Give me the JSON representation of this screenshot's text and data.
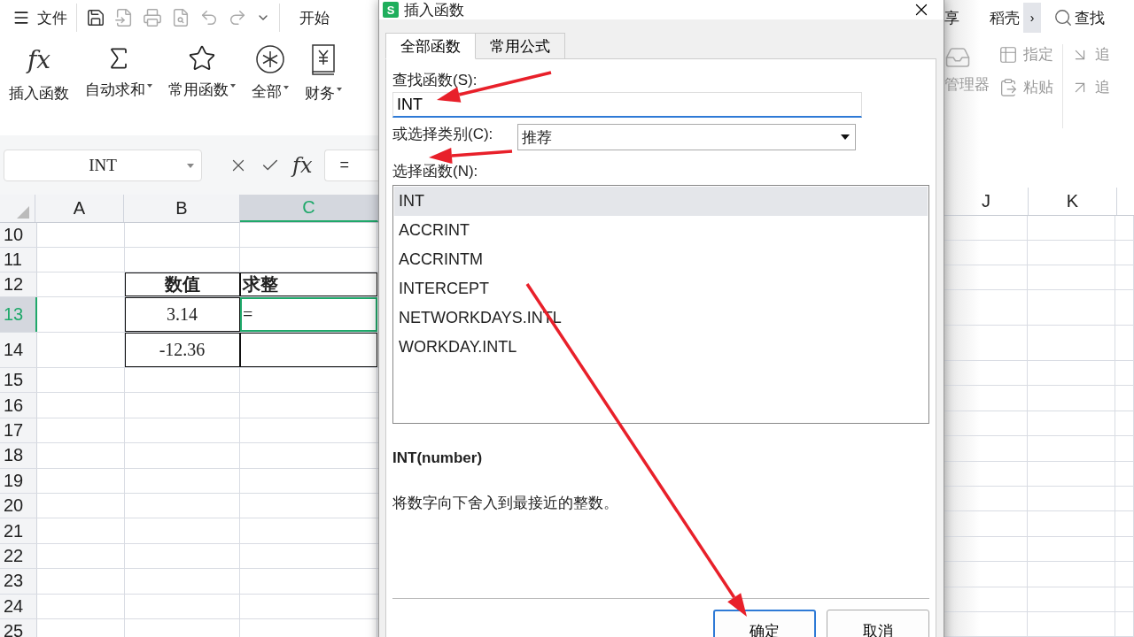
{
  "quick_bar": {
    "menu_label": "文件",
    "tab_label": "开始"
  },
  "ribbon": [
    {
      "icon_text": "fx",
      "label": "插入函数",
      "dropdown": false
    },
    {
      "label": "自动求和",
      "dropdown": true
    },
    {
      "label": "常用函数",
      "dropdown": true
    },
    {
      "label": "全部",
      "dropdown": true
    },
    {
      "label": "财务",
      "dropdown": true
    }
  ],
  "formula_bar": {
    "name_box": "INT",
    "fx_label": "fx",
    "content": "="
  },
  "sheet": {
    "columns": [
      {
        "label": "A",
        "selected": false
      },
      {
        "label": "B",
        "selected": false
      },
      {
        "label": "C",
        "selected": true
      }
    ],
    "rows": [
      {
        "number": "10",
        "selected": false,
        "cells": []
      },
      {
        "number": "11",
        "selected": false,
        "cells": []
      },
      {
        "number": "12",
        "selected": false,
        "cells": [
          "",
          {
            "text": "数值",
            "bold": true,
            "bordered": true,
            "active": false
          },
          {
            "text": "求整",
            "bold": true,
            "bordered": true,
            "active": false
          }
        ]
      },
      {
        "number": "13",
        "selected": true,
        "cells": [
          "",
          {
            "text": "3.14",
            "bold": false,
            "bordered": true,
            "active": false
          },
          {
            "text": "=",
            "bold": false,
            "bordered": true,
            "active": true
          }
        ]
      },
      {
        "number": "14",
        "selected": false,
        "cells": [
          "",
          {
            "text": "-12.36",
            "bold": false,
            "bordered": true,
            "active": false
          },
          {
            "text": "",
            "bold": false,
            "bordered": true,
            "active": false
          }
        ]
      },
      {
        "number": "15",
        "selected": false,
        "cells": []
      },
      {
        "number": "16",
        "selected": false,
        "cells": []
      },
      {
        "number": "17",
        "selected": false,
        "cells": []
      },
      {
        "number": "18",
        "selected": false,
        "cells": []
      },
      {
        "number": "19",
        "selected": false,
        "cells": []
      },
      {
        "number": "20",
        "selected": false,
        "cells": []
      },
      {
        "number": "21",
        "selected": false,
        "cells": []
      },
      {
        "number": "22",
        "selected": false,
        "cells": []
      },
      {
        "number": "23",
        "selected": false,
        "cells": []
      },
      {
        "number": "24",
        "selected": false,
        "cells": []
      },
      {
        "number": "25",
        "selected": false,
        "cells": []
      }
    ],
    "right_columns": [
      {
        "label": "J"
      },
      {
        "label": "K"
      }
    ]
  },
  "right_toolbar": {
    "tab_fragment": "享",
    "tab_label": "稻壳",
    "more": "›",
    "search_label": "查找"
  },
  "right_ribbon": {
    "manager_label": "管理器",
    "items": [
      {
        "label": "指定"
      },
      {
        "label": "粘贴"
      }
    ],
    "cut_items": [
      {
        "label": "追"
      },
      {
        "label": "追"
      }
    ]
  },
  "dialog": {
    "app_icon": "S",
    "title": "插入函数",
    "tabs": [
      {
        "label": "全部函数",
        "selected": true
      },
      {
        "label": "常用公式",
        "selected": false
      }
    ],
    "search_label": "查找函数(S):",
    "search_value": "INT",
    "category_label": "或选择类别(C):",
    "category_value": "推荐",
    "list_label": "选择函数(N):",
    "functions": [
      {
        "name": "INT",
        "selected": true
      },
      {
        "name": "ACCRINT",
        "selected": false
      },
      {
        "name": "ACCRINTM",
        "selected": false
      },
      {
        "name": "INTERCEPT",
        "selected": false
      },
      {
        "name": "NETWORKDAYS.INTL",
        "selected": false
      },
      {
        "name": "WORKDAY.INTL",
        "selected": false
      }
    ],
    "signature": "INT(number)",
    "description": "将数字向下舍入到最接近的整数。",
    "buttons": [
      {
        "label": "确定",
        "kind": "primary"
      },
      {
        "label": "取消",
        "kind": "secondary"
      }
    ]
  }
}
